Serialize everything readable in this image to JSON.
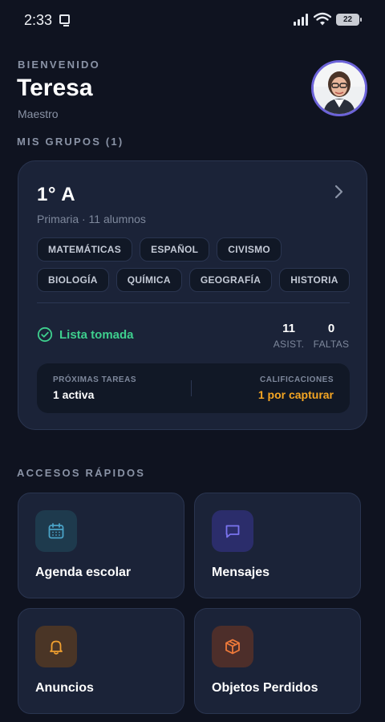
{
  "status_bar": {
    "time": "2:33",
    "battery": "22"
  },
  "header": {
    "welcome": "BIENVENIDO",
    "name": "Teresa",
    "role": "Maestro"
  },
  "groups_section": {
    "title": "MIS GRUPOS (1)"
  },
  "group": {
    "name": "1° A",
    "subtitle": "Primaria · 11 alumnos",
    "subjects": [
      "MATEMÁTICAS",
      "ESPAÑOL",
      "CIVISMO",
      "BIOLOGÍA",
      "QUÍMICA",
      "GEOGRAFÍA",
      "HISTORIA"
    ],
    "attendance_status": "Lista tomada",
    "attendance_count": "11",
    "attendance_label": "ASIST.",
    "absences_count": "0",
    "absences_label": "FALTAS",
    "tasks_label": "PRÓXIMAS TAREAS",
    "tasks_value": "1 activa",
    "grades_label": "CALIFICACIONES",
    "grades_value": "1 por capturar"
  },
  "quick_access": {
    "title": "ACCESOS RÁPIDOS",
    "tiles": [
      {
        "label": "Agenda escolar",
        "icon": "calendar-icon"
      },
      {
        "label": "Mensajes",
        "icon": "message-icon"
      },
      {
        "label": "Anuncios",
        "icon": "bell-icon"
      },
      {
        "label": "Objetos Perdidos",
        "icon": "box-icon"
      }
    ]
  },
  "colors": {
    "background": "#0f1320",
    "card": "#1b2338",
    "success": "#3ecf8e",
    "warning": "#f5a623",
    "avatar_ring": "#6c63d9"
  }
}
